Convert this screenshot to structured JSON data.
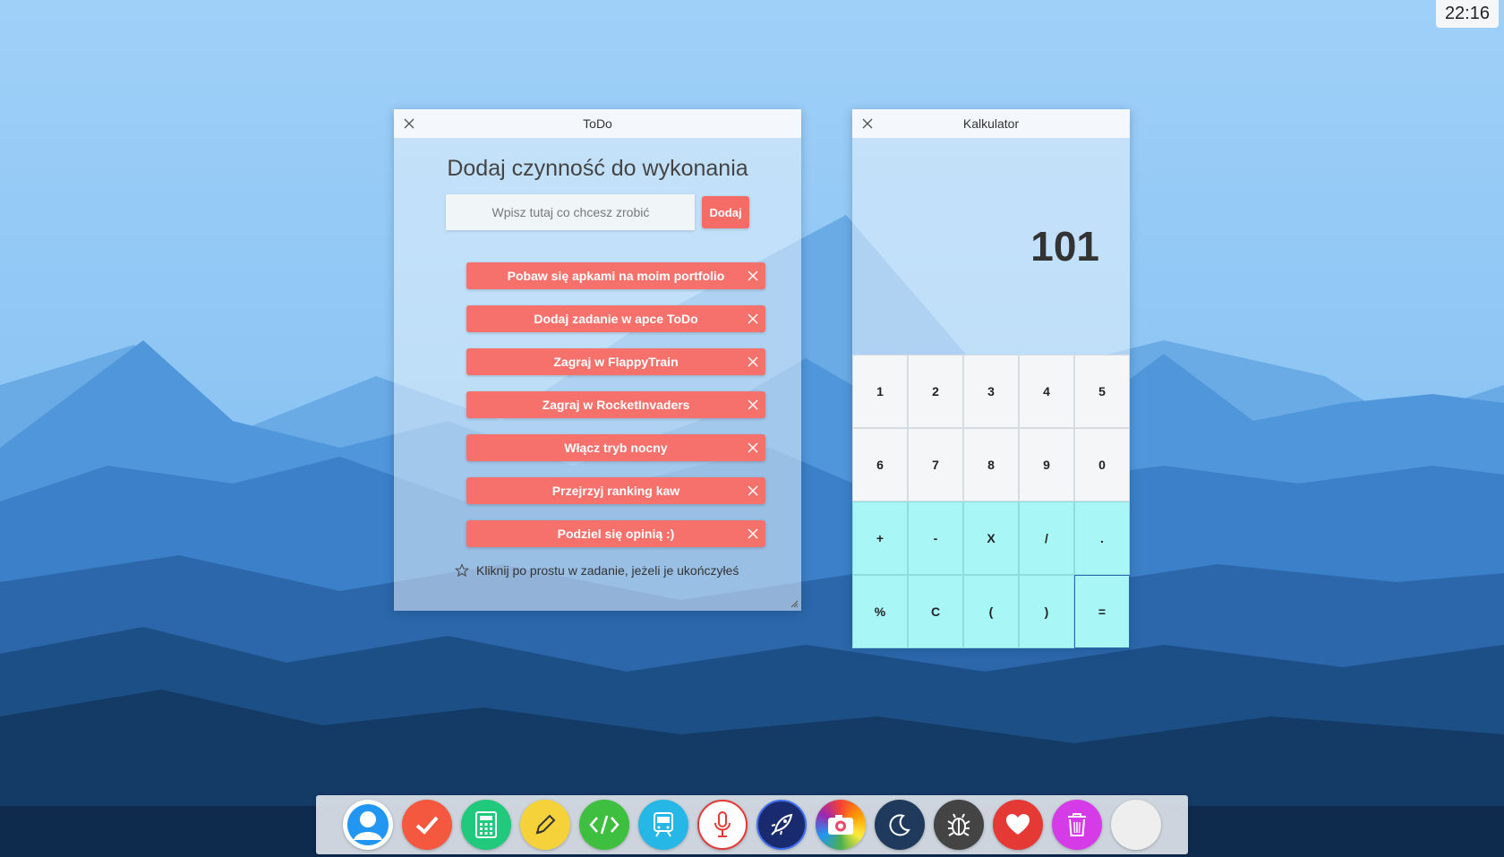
{
  "clock": "22:16",
  "todo": {
    "title": "ToDo",
    "heading": "Dodaj czynność do wykonania",
    "input_placeholder": "Wpisz tutaj co chcesz zrobić",
    "add_label": "Dodaj",
    "tasks": [
      "Pobaw się apkami na moim portfolio",
      "Dodaj zadanie w apce ToDo",
      "Zagraj w FlappyTrain",
      "Zagraj w RocketInvaders",
      "Włącz tryb nocny",
      "Przejrzyj ranking kaw",
      "Podziel się opinią :)"
    ],
    "hint": "Kliknij po prostu w zadanie, jeżeli je ukończyłeś"
  },
  "calc": {
    "title": "Kalkulator",
    "display": "101",
    "keys": [
      "1",
      "2",
      "3",
      "4",
      "5",
      "6",
      "7",
      "8",
      "9",
      "0",
      "+",
      "-",
      "X",
      "/",
      ".",
      "%",
      "C",
      "(",
      ")",
      "="
    ]
  },
  "dock": {
    "icons": [
      {
        "name": "profile-icon",
        "color": "#2196f3"
      },
      {
        "name": "todo-check-icon",
        "color": "#f4583f"
      },
      {
        "name": "calculator-icon",
        "color": "#21c97d"
      },
      {
        "name": "pencil-icon",
        "color": "#f5d13a"
      },
      {
        "name": "code-icon",
        "color": "#3fbf3f"
      },
      {
        "name": "train-icon",
        "color": "#27b7e6"
      },
      {
        "name": "microphone-icon",
        "color": "#ffffff"
      },
      {
        "name": "rocket-icon",
        "color": "#1a2a6e"
      },
      {
        "name": "camera-icon",
        "color": "#e84a6a"
      },
      {
        "name": "moon-icon",
        "color": "#1f3a5c"
      },
      {
        "name": "bug-icon",
        "color": "#444444"
      },
      {
        "name": "heart-icon",
        "color": "#e53935"
      },
      {
        "name": "trash-icon",
        "color": "#d63be8"
      },
      {
        "name": "blank-icon",
        "color": "#eeeeee"
      }
    ]
  }
}
